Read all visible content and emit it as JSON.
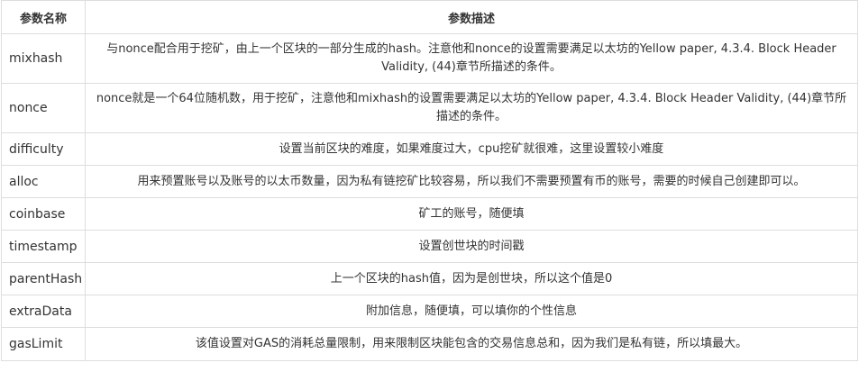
{
  "headers": {
    "name": "参数名称",
    "desc": "参数描述"
  },
  "rows": [
    {
      "name": "mixhash",
      "desc": "与nonce配合用于挖矿，由上一个区块的一部分生成的hash。注意他和nonce的设置需要满足以太坊的Yellow paper, 4.3.4. Block Header Validity, (44)章节所描述的条件。"
    },
    {
      "name": "nonce",
      "desc": "nonce就是一个64位随机数，用于挖矿，注意他和mixhash的设置需要满足以太坊的Yellow paper, 4.3.4. Block Header Validity, (44)章节所描述的条件。"
    },
    {
      "name": "difficulty",
      "desc": "设置当前区块的难度，如果难度过大，cpu挖矿就很难，这里设置较小难度"
    },
    {
      "name": "alloc",
      "desc": "用来预置账号以及账号的以太币数量，因为私有链挖矿比较容易，所以我们不需要预置有币的账号，需要的时候自己创建即可以。"
    },
    {
      "name": "coinbase",
      "desc": "矿工的账号，随便填"
    },
    {
      "name": "timestamp",
      "desc": "设置创世块的时间戳"
    },
    {
      "name": "parentHash",
      "desc": "上一个区块的hash值，因为是创世块，所以这个值是0"
    },
    {
      "name": "extraData",
      "desc": "附加信息，随便填，可以填你的个性信息"
    },
    {
      "name": "gasLimit",
      "desc": "该值设置对GAS的消耗总量限制，用来限制区块能包含的交易信息总和，因为我们是私有链，所以填最大。"
    }
  ]
}
